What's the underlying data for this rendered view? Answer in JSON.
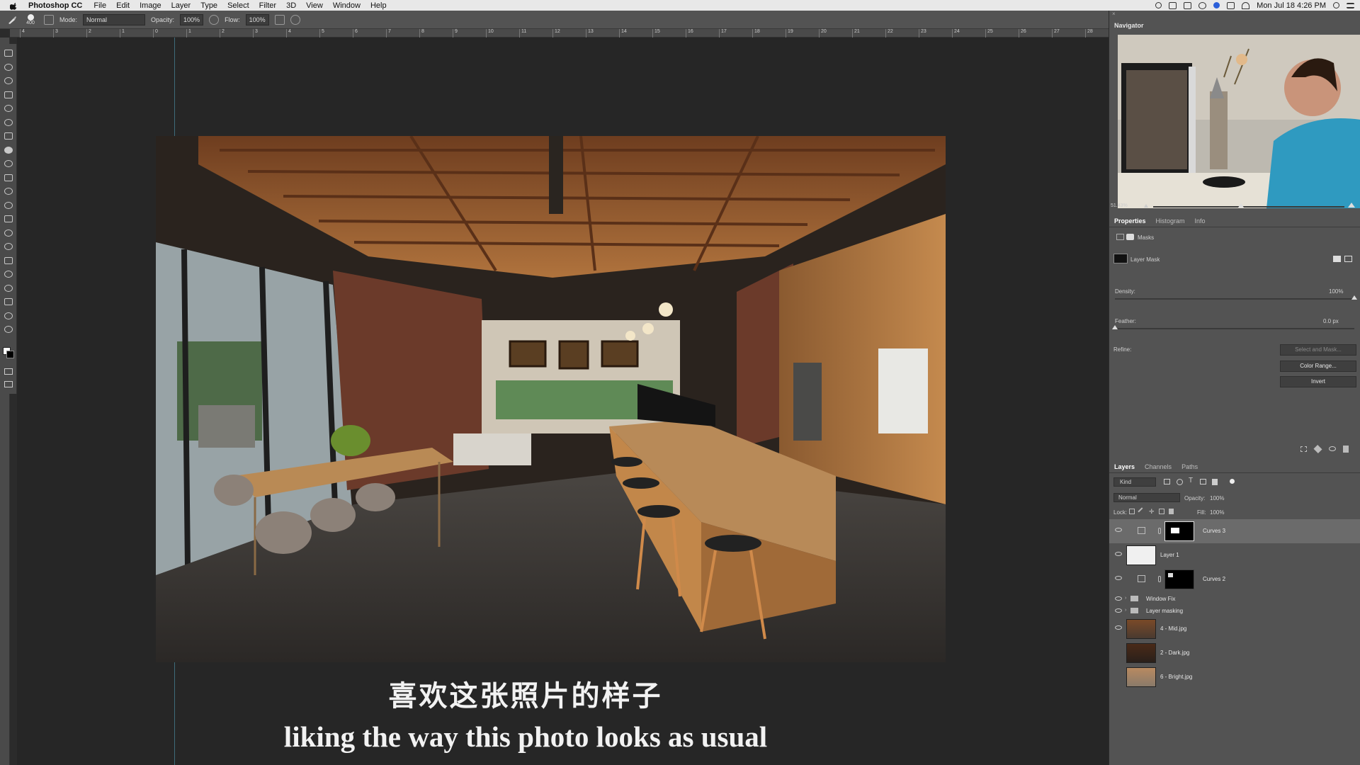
{
  "menubar": {
    "app_name": "Photoshop CC",
    "items": [
      "File",
      "Edit",
      "Image",
      "Layer",
      "Type",
      "Select",
      "Filter",
      "3D",
      "View",
      "Window",
      "Help"
    ],
    "clock": "Mon Jul 18  4:26 PM"
  },
  "options": {
    "brush_size": "400",
    "mode_label": "Mode:",
    "mode_value": "Normal",
    "opacity_label": "Opacity:",
    "opacity_value": "100%",
    "flow_label": "Flow:",
    "flow_value": "100%"
  },
  "ruler": {
    "ticks": [
      "4",
      "3",
      "2",
      "1",
      "0",
      "1",
      "2",
      "3",
      "4",
      "5",
      "6",
      "7",
      "8",
      "9",
      "10",
      "11",
      "12",
      "13",
      "14",
      "15",
      "16",
      "17",
      "18",
      "19",
      "20",
      "21",
      "22",
      "23",
      "24",
      "25",
      "26",
      "27",
      "28"
    ]
  },
  "subtitles": {
    "cn": "喜欢这张照片的样子",
    "en": "liking the way this photo looks as usual"
  },
  "navigator": {
    "title": "Navigator",
    "zoom": "51.43%"
  },
  "properties": {
    "tabs": [
      "Properties",
      "Histogram",
      "Info"
    ],
    "masks_label": "Masks",
    "layer_mask_label": "Layer Mask",
    "density_label": "Density:",
    "density_value": "100%",
    "density_level": 1.0,
    "feather_label": "Feather:",
    "feather_value": "0.0 px",
    "feather_level": 0.0,
    "refine_label": "Refine:",
    "select_mask_btn": "Select and Mask...",
    "color_range_btn": "Color Range...",
    "invert_btn": "Invert"
  },
  "layers_panel": {
    "tabs": [
      "Layers",
      "Channels",
      "Paths"
    ],
    "filter_label": "Kind",
    "blend_mode": "Normal",
    "opacity_label": "Opacity:",
    "opacity_value": "100%",
    "lock_label": "Lock:",
    "fill_label": "Fill:",
    "fill_value": "100%",
    "layers": [
      {
        "name": "Curves 3",
        "selected": true,
        "type": "adjust"
      },
      {
        "name": "Layer 1",
        "selected": false,
        "type": "white"
      },
      {
        "name": "Curves 2",
        "selected": false,
        "type": "adjust"
      },
      {
        "name": "Window Fix",
        "type": "group"
      },
      {
        "name": "Layer masking",
        "type": "group"
      },
      {
        "name": "4 - Mid.jpg",
        "type": "photo"
      },
      {
        "name": "2 - Dark.jpg",
        "type": "photo"
      },
      {
        "name": "6 - Bright.jpg",
        "type": "photo"
      }
    ]
  }
}
